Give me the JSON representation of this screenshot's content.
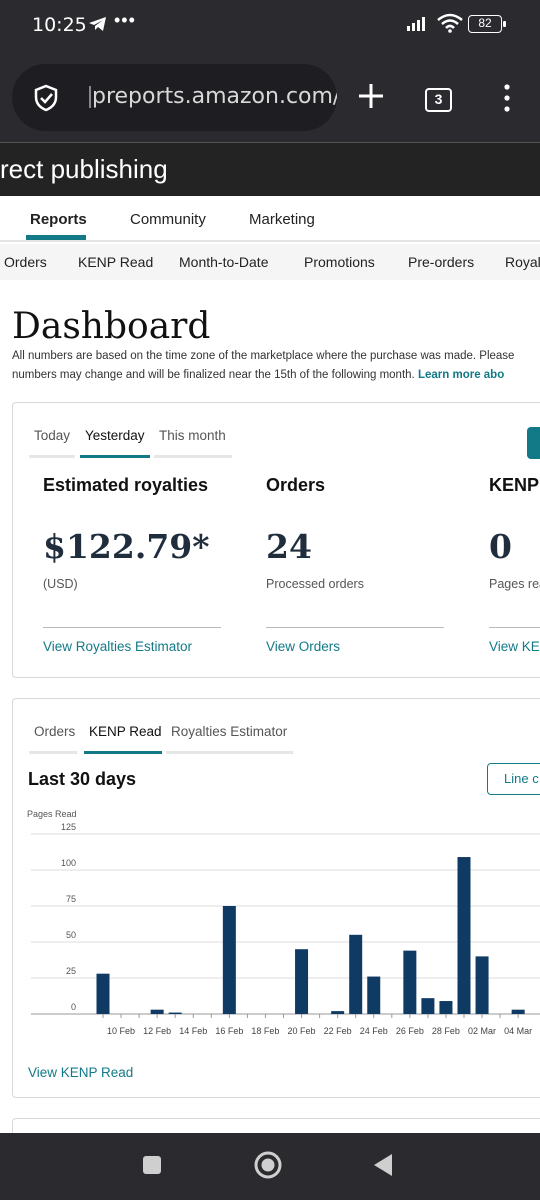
{
  "status_bar": {
    "time": "10:25",
    "dots": "•••",
    "battery": "82"
  },
  "browser": {
    "url": "preports.amazon.com/d",
    "tab_count": "3"
  },
  "kdp": {
    "title": "rect publishing"
  },
  "top_nav": [
    {
      "label": "Reports",
      "active": true
    },
    {
      "label": "Community",
      "active": false
    },
    {
      "label": "Marketing",
      "active": false
    }
  ],
  "sub_nav": [
    "Orders",
    "KENP Read",
    "Month-to-Date",
    "Promotions",
    "Pre-orders",
    "Royalt"
  ],
  "dashboard": {
    "title": "Dashboard",
    "note_line1": "All numbers are based on the time zone of the marketplace where the purchase was made. Please",
    "note_line2": "numbers may change and will be finalized near the 15th of the following month.",
    "learn_more": "Learn more abo"
  },
  "summary_card": {
    "tabs": [
      {
        "label": "Today",
        "active": false
      },
      {
        "label": "Yesterday",
        "active": true
      },
      {
        "label": "This month",
        "active": false
      }
    ],
    "metrics": [
      {
        "heading": "Estimated royalties",
        "value": "$122.79*",
        "sub": "(USD)",
        "link": "View Royalties Estimator"
      },
      {
        "heading": "Orders",
        "value": "24",
        "sub": "Processed orders",
        "link": "View Orders"
      },
      {
        "heading": "KENP",
        "value": "0",
        "sub": "Pages rea",
        "link": "View KEN"
      }
    ]
  },
  "chart_card": {
    "tabs": [
      {
        "label": "Orders",
        "active": false
      },
      {
        "label": "KENP Read",
        "active": true
      },
      {
        "label": "Royalties Estimator",
        "active": false
      }
    ],
    "heading": "Last 30 days",
    "line_button": "Line c",
    "view_link": "View KENP Read"
  },
  "chart_data": {
    "type": "bar",
    "ylabel": "Pages Read",
    "ylim": [
      0,
      125
    ],
    "yticks": [
      0,
      25,
      50,
      75,
      100,
      125
    ],
    "grid": true,
    "color": "#0f3a63",
    "x_tick_labels": [
      "10 Feb",
      "12 Feb",
      "14 Feb",
      "16 Feb",
      "18 Feb",
      "20 Feb",
      "22 Feb",
      "24 Feb",
      "26 Feb",
      "28 Feb",
      "02 Mar",
      "04 Mar"
    ],
    "categories": [
      "09 Feb",
      "10 Feb",
      "11 Feb",
      "12 Feb",
      "13 Feb",
      "14 Feb",
      "15 Feb",
      "16 Feb",
      "17 Feb",
      "18 Feb",
      "19 Feb",
      "20 Feb",
      "21 Feb",
      "22 Feb",
      "23 Feb",
      "24 Feb",
      "25 Feb",
      "26 Feb",
      "27 Feb",
      "28 Feb",
      "01 Mar",
      "02 Mar",
      "03 Mar",
      "04 Mar"
    ],
    "values": [
      28,
      0,
      0,
      3,
      1,
      0,
      0,
      75,
      0,
      0,
      0,
      45,
      0,
      2,
      55,
      26,
      0,
      44,
      11,
      9,
      109,
      40,
      0,
      3
    ]
  }
}
